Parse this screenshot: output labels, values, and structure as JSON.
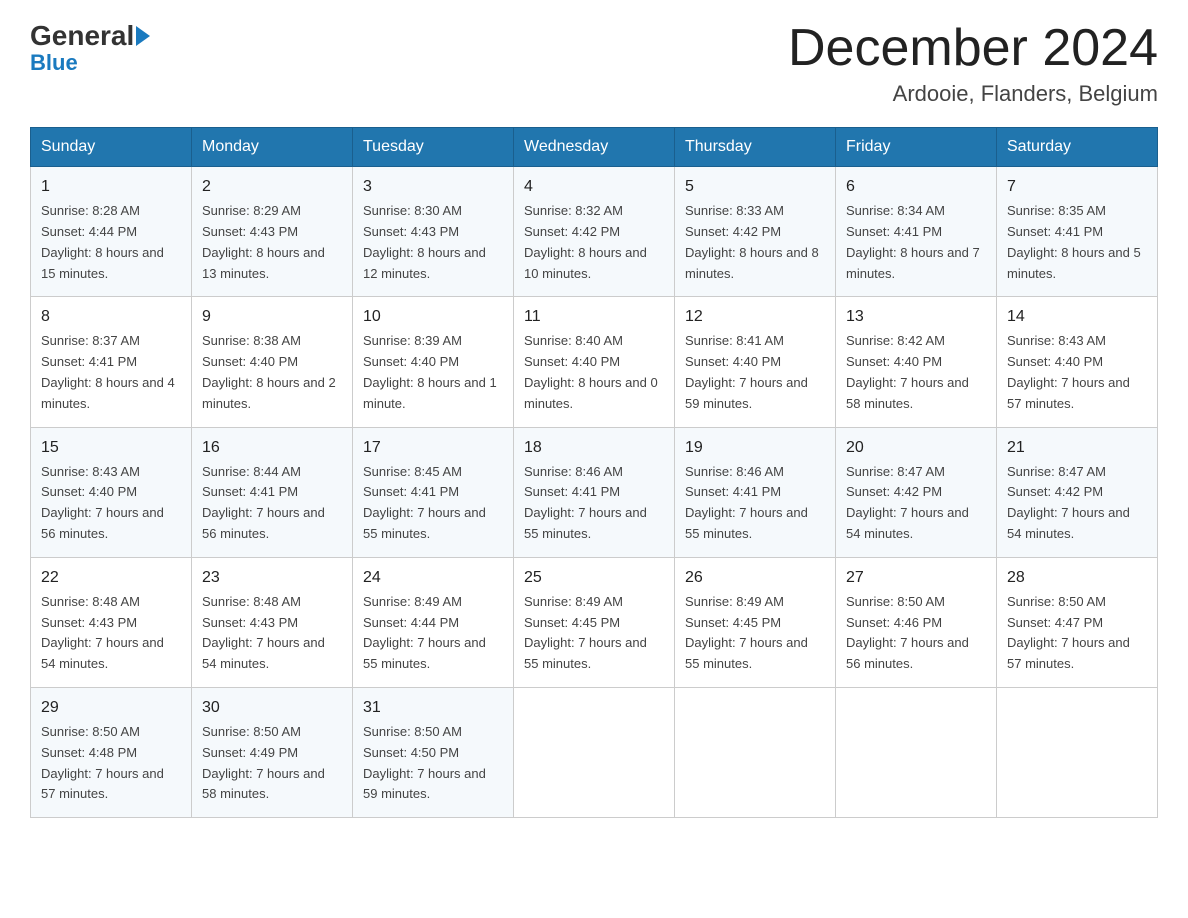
{
  "header": {
    "logo_general": "General",
    "logo_blue": "Blue",
    "month_title": "December 2024",
    "location": "Ardooie, Flanders, Belgium"
  },
  "days_of_week": [
    "Sunday",
    "Monday",
    "Tuesday",
    "Wednesday",
    "Thursday",
    "Friday",
    "Saturday"
  ],
  "weeks": [
    [
      {
        "day": "1",
        "sunrise": "8:28 AM",
        "sunset": "4:44 PM",
        "daylight": "8 hours and 15 minutes."
      },
      {
        "day": "2",
        "sunrise": "8:29 AM",
        "sunset": "4:43 PM",
        "daylight": "8 hours and 13 minutes."
      },
      {
        "day": "3",
        "sunrise": "8:30 AM",
        "sunset": "4:43 PM",
        "daylight": "8 hours and 12 minutes."
      },
      {
        "day": "4",
        "sunrise": "8:32 AM",
        "sunset": "4:42 PM",
        "daylight": "8 hours and 10 minutes."
      },
      {
        "day": "5",
        "sunrise": "8:33 AM",
        "sunset": "4:42 PM",
        "daylight": "8 hours and 8 minutes."
      },
      {
        "day": "6",
        "sunrise": "8:34 AM",
        "sunset": "4:41 PM",
        "daylight": "8 hours and 7 minutes."
      },
      {
        "day": "7",
        "sunrise": "8:35 AM",
        "sunset": "4:41 PM",
        "daylight": "8 hours and 5 minutes."
      }
    ],
    [
      {
        "day": "8",
        "sunrise": "8:37 AM",
        "sunset": "4:41 PM",
        "daylight": "8 hours and 4 minutes."
      },
      {
        "day": "9",
        "sunrise": "8:38 AM",
        "sunset": "4:40 PM",
        "daylight": "8 hours and 2 minutes."
      },
      {
        "day": "10",
        "sunrise": "8:39 AM",
        "sunset": "4:40 PM",
        "daylight": "8 hours and 1 minute."
      },
      {
        "day": "11",
        "sunrise": "8:40 AM",
        "sunset": "4:40 PM",
        "daylight": "8 hours and 0 minutes."
      },
      {
        "day": "12",
        "sunrise": "8:41 AM",
        "sunset": "4:40 PM",
        "daylight": "7 hours and 59 minutes."
      },
      {
        "day": "13",
        "sunrise": "8:42 AM",
        "sunset": "4:40 PM",
        "daylight": "7 hours and 58 minutes."
      },
      {
        "day": "14",
        "sunrise": "8:43 AM",
        "sunset": "4:40 PM",
        "daylight": "7 hours and 57 minutes."
      }
    ],
    [
      {
        "day": "15",
        "sunrise": "8:43 AM",
        "sunset": "4:40 PM",
        "daylight": "7 hours and 56 minutes."
      },
      {
        "day": "16",
        "sunrise": "8:44 AM",
        "sunset": "4:41 PM",
        "daylight": "7 hours and 56 minutes."
      },
      {
        "day": "17",
        "sunrise": "8:45 AM",
        "sunset": "4:41 PM",
        "daylight": "7 hours and 55 minutes."
      },
      {
        "day": "18",
        "sunrise": "8:46 AM",
        "sunset": "4:41 PM",
        "daylight": "7 hours and 55 minutes."
      },
      {
        "day": "19",
        "sunrise": "8:46 AM",
        "sunset": "4:41 PM",
        "daylight": "7 hours and 55 minutes."
      },
      {
        "day": "20",
        "sunrise": "8:47 AM",
        "sunset": "4:42 PM",
        "daylight": "7 hours and 54 minutes."
      },
      {
        "day": "21",
        "sunrise": "8:47 AM",
        "sunset": "4:42 PM",
        "daylight": "7 hours and 54 minutes."
      }
    ],
    [
      {
        "day": "22",
        "sunrise": "8:48 AM",
        "sunset": "4:43 PM",
        "daylight": "7 hours and 54 minutes."
      },
      {
        "day": "23",
        "sunrise": "8:48 AM",
        "sunset": "4:43 PM",
        "daylight": "7 hours and 54 minutes."
      },
      {
        "day": "24",
        "sunrise": "8:49 AM",
        "sunset": "4:44 PM",
        "daylight": "7 hours and 55 minutes."
      },
      {
        "day": "25",
        "sunrise": "8:49 AM",
        "sunset": "4:45 PM",
        "daylight": "7 hours and 55 minutes."
      },
      {
        "day": "26",
        "sunrise": "8:49 AM",
        "sunset": "4:45 PM",
        "daylight": "7 hours and 55 minutes."
      },
      {
        "day": "27",
        "sunrise": "8:50 AM",
        "sunset": "4:46 PM",
        "daylight": "7 hours and 56 minutes."
      },
      {
        "day": "28",
        "sunrise": "8:50 AM",
        "sunset": "4:47 PM",
        "daylight": "7 hours and 57 minutes."
      }
    ],
    [
      {
        "day": "29",
        "sunrise": "8:50 AM",
        "sunset": "4:48 PM",
        "daylight": "7 hours and 57 minutes."
      },
      {
        "day": "30",
        "sunrise": "8:50 AM",
        "sunset": "4:49 PM",
        "daylight": "7 hours and 58 minutes."
      },
      {
        "day": "31",
        "sunrise": "8:50 AM",
        "sunset": "4:50 PM",
        "daylight": "7 hours and 59 minutes."
      },
      null,
      null,
      null,
      null
    ]
  ]
}
